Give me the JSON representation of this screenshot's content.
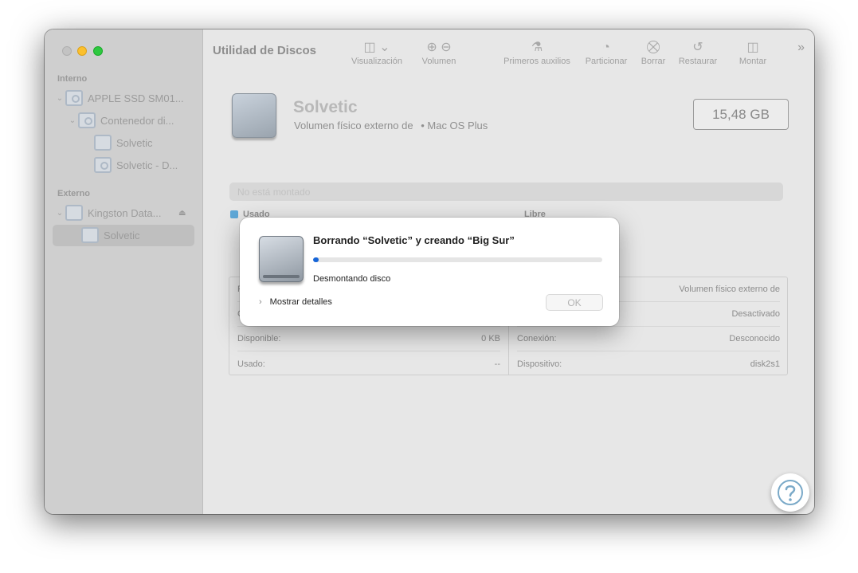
{
  "window": {
    "app_title": "Utilidad de Discos"
  },
  "sidebar": {
    "sections": {
      "internal": "Interno",
      "external": "Externo"
    },
    "items": [
      {
        "label": "APPLE SSD SM01..."
      },
      {
        "label": "Contenedor di..."
      },
      {
        "label": "Solvetic"
      },
      {
        "label": "Solvetic - D..."
      },
      {
        "label": "Kingston Data..."
      },
      {
        "label": "Solvetic"
      }
    ]
  },
  "toolbar": {
    "view": "Visualización",
    "volume": "Volumen",
    "first_aid": "Primeros auxilios",
    "partition": "Particionar",
    "erase": "Borrar",
    "restore": "Restaurar",
    "mount": "Montar"
  },
  "volume": {
    "name": "Solvetic",
    "subtitle": "Volumen físico externo de",
    "format": "• Mac OS Plus",
    "size": "15,48 GB",
    "usage_bar_label": "No está montado",
    "legend_used": "Usado",
    "legend_free": "Libre"
  },
  "info": {
    "left": [
      {
        "label": "P",
        "value": ""
      },
      {
        "label": "C",
        "value": ""
      },
      {
        "label": "Disponible:",
        "value": "0 KB"
      },
      {
        "label": "Usado:",
        "value": "--"
      }
    ],
    "right": [
      {
        "label": "",
        "value": "Volumen físico externo de"
      },
      {
        "label": "",
        "value": "Desactivado"
      },
      {
        "label": "Conexión:",
        "value": "Desconocido"
      },
      {
        "label": "Dispositivo:",
        "value": "disk2s1"
      }
    ]
  },
  "dialog": {
    "title": "Borrando “Solvetic” y creando “Big Sur”",
    "status": "Desmontando disco",
    "progress_fraction": 0.02,
    "details_label": "Mostrar detalles",
    "ok_label": "OK"
  },
  "colors": {
    "accent": "#1665d8",
    "used_swatch": "#5fa8d8"
  }
}
